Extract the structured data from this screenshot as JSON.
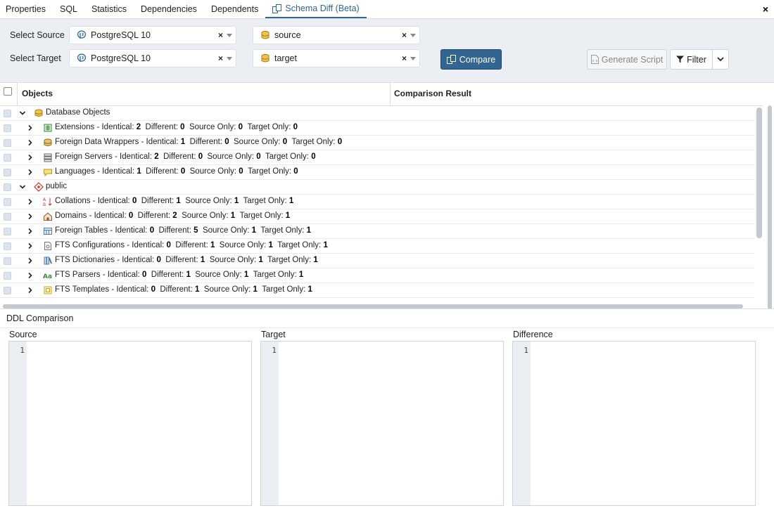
{
  "tabs": [
    {
      "label": "Properties"
    },
    {
      "label": "SQL"
    },
    {
      "label": "Statistics"
    },
    {
      "label": "Dependencies"
    },
    {
      "label": "Dependents"
    },
    {
      "label": "Schema Diff (Beta)",
      "active": true
    }
  ],
  "close_label": "×",
  "source": {
    "label": "Select Source",
    "server": "PostgreSQL 10",
    "database": "source"
  },
  "target": {
    "label": "Select Target",
    "server": "PostgreSQL 10",
    "database": "target"
  },
  "clear_glyph": "×",
  "buttons": {
    "compare": "Compare",
    "generate_script": "Generate Script",
    "filter": "Filter"
  },
  "grid": {
    "col_objects": "Objects",
    "col_result": "Comparison Result",
    "rows": [
      {
        "level": 0,
        "expanded": true,
        "icon": "database-objects-icon",
        "name": "Database Objects"
      },
      {
        "level": 1,
        "icon": "extensions-icon",
        "name": "Extensions",
        "identical": "2",
        "different": "0",
        "source_only": "0",
        "target_only": "0"
      },
      {
        "level": 1,
        "icon": "foreign-data-wrappers-icon",
        "name": "Foreign Data Wrappers",
        "identical": "1",
        "different": "0",
        "source_only": "0",
        "target_only": "0"
      },
      {
        "level": 1,
        "icon": "foreign-servers-icon",
        "name": "Foreign Servers",
        "identical": "2",
        "different": "0",
        "source_only": "0",
        "target_only": "0"
      },
      {
        "level": 1,
        "icon": "languages-icon",
        "name": "Languages",
        "identical": "1",
        "different": "0",
        "source_only": "0",
        "target_only": "0"
      },
      {
        "level": 0,
        "expanded": true,
        "icon": "schema-icon",
        "name": "public"
      },
      {
        "level": 1,
        "icon": "collations-icon",
        "name": "Collations",
        "identical": "0",
        "different": "1",
        "source_only": "1",
        "target_only": "1"
      },
      {
        "level": 1,
        "icon": "domains-icon",
        "name": "Domains",
        "identical": "0",
        "different": "2",
        "source_only": "1",
        "target_only": "1"
      },
      {
        "level": 1,
        "icon": "foreign-tables-icon",
        "name": "Foreign Tables",
        "identical": "0",
        "different": "5",
        "source_only": "1",
        "target_only": "1"
      },
      {
        "level": 1,
        "icon": "fts-configurations-icon",
        "name": "FTS Configurations",
        "identical": "0",
        "different": "1",
        "source_only": "1",
        "target_only": "1"
      },
      {
        "level": 1,
        "icon": "fts-dictionaries-icon",
        "name": "FTS Dictionaries",
        "identical": "0",
        "different": "1",
        "source_only": "1",
        "target_only": "1"
      },
      {
        "level": 1,
        "icon": "fts-parsers-icon",
        "name": "FTS Parsers",
        "identical": "0",
        "different": "1",
        "source_only": "1",
        "target_only": "1"
      },
      {
        "level": 1,
        "icon": "fts-templates-icon",
        "name": "FTS Templates",
        "identical": "0",
        "different": "1",
        "source_only": "1",
        "target_only": "1"
      }
    ],
    "labels": {
      "identical": " - Identical: ",
      "different": "Different: ",
      "source_only": "Source Only: ",
      "target_only": "Target Only: "
    }
  },
  "ddl": {
    "title": "DDL Comparison",
    "panes": [
      {
        "label": "Source",
        "line": "1"
      },
      {
        "label": "Target",
        "line": "1"
      },
      {
        "label": "Difference",
        "line": "1"
      }
    ]
  },
  "colors": {
    "accent": "#326690",
    "panel_bg": "#ebeef3"
  }
}
